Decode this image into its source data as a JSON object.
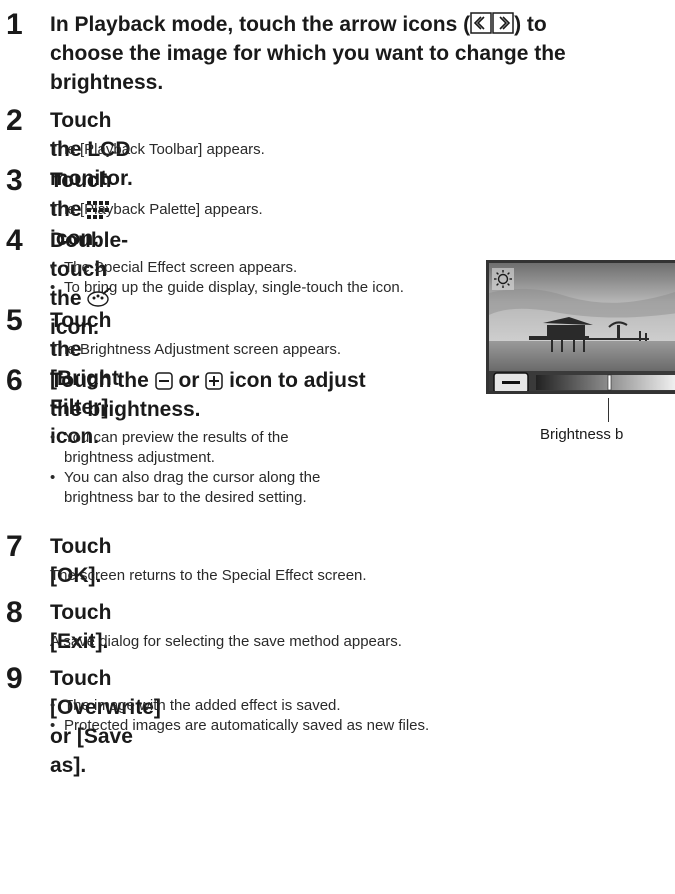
{
  "steps": [
    {
      "num": "1",
      "head_a": "In Playback mode, touch the arrow icons (",
      "head_b": ") to",
      "head_c": "choose the image for which you want to change the",
      "head_d": "brightness."
    },
    {
      "num": "2",
      "head": "Touch the LCD monitor.",
      "desc": "The [Playback Toolbar] appears."
    },
    {
      "num": "3",
      "head_a": "Touch the ",
      "head_b": " icon.",
      "desc": "The [Playback Palette] appears."
    },
    {
      "num": "4",
      "head_a": "Double-touch the ",
      "head_b": " icon.",
      "bullets": [
        "The Special Effect screen appears.",
        "To bring up the guide display, single-touch the icon."
      ]
    },
    {
      "num": "5",
      "head": "Touch the [Bright Filter] icon.",
      "desc": "The Brightness Adjustment screen appears."
    },
    {
      "num": "6",
      "head_a": "Touch the ",
      "head_b": " or ",
      "head_c": " icon to adjust",
      "head_d": "the brightness.",
      "bullets": [
        "You can preview the results of the",
        "brightness adjustment.",
        "You can also drag the cursor along the",
        "brightness bar to the desired setting."
      ]
    },
    {
      "num": "7",
      "head": "Touch [OK].",
      "desc": "The screen returns to the Special Effect screen."
    },
    {
      "num": "8",
      "head": "Touch [Exit].",
      "desc": "A save dialog for selecting the save method appears."
    },
    {
      "num": "9",
      "head": "Touch [Overwrite] or [Save as].",
      "bullets": [
        "The image with the added effect is saved.",
        "Protected images are automatically saved as new files."
      ]
    }
  ],
  "figure": {
    "caption": "Brightness b"
  },
  "icons": [
    "left-arrow-icon",
    "right-arrow-icon",
    "palette-grid-icon",
    "special-effect-icon",
    "minus-icon",
    "plus-icon",
    "brightness-icon"
  ]
}
